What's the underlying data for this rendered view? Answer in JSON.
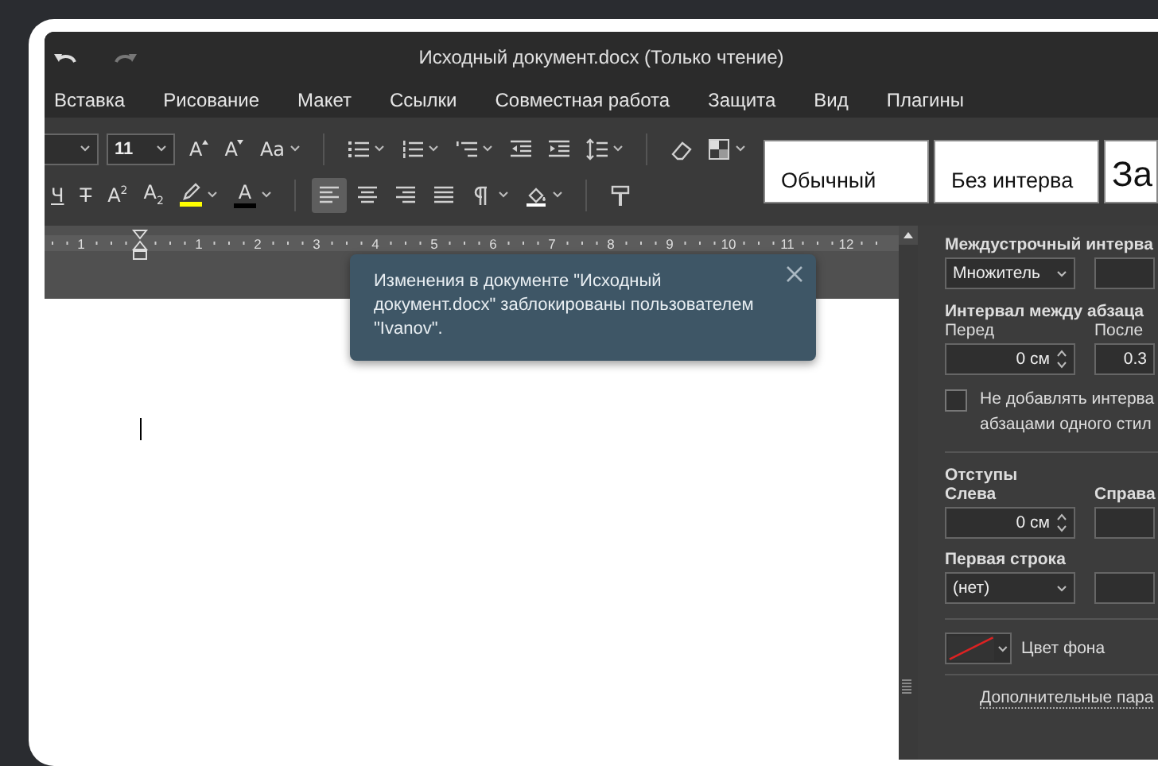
{
  "title_bar": {
    "title": "Исходный документ.docx (Только чтение)"
  },
  "menu": [
    "Вставка",
    "Рисование",
    "Макет",
    "Ссылки",
    "Совместная работа",
    "Защита",
    "Вид",
    "Плагины"
  ],
  "toolbar": {
    "font_size": "11",
    "row_1": [
      {
        "kind": "grow-font",
        "glyph": "A",
        "caret": false
      },
      {
        "kind": "shrink-font",
        "glyph": "A",
        "caret": false
      },
      {
        "kind": "change-case",
        "glyph": "Aa",
        "caret": true
      },
      {
        "kind": "sep"
      },
      {
        "kind": "bullets",
        "caret": true
      },
      {
        "kind": "numbering",
        "caret": true
      },
      {
        "kind": "multilevel",
        "caret": true
      },
      {
        "kind": "outdent",
        "caret": false
      },
      {
        "kind": "indent",
        "caret": false
      },
      {
        "kind": "line-spacing",
        "caret": true
      },
      {
        "kind": "sep"
      },
      {
        "kind": "eraser",
        "caret": false
      },
      {
        "kind": "shading",
        "caret": true
      }
    ],
    "row_2": [
      {
        "kind": "underline",
        "glyph": "Ч",
        "caret": false
      },
      {
        "kind": "strike",
        "glyph": "Т",
        "caret": false
      },
      {
        "kind": "superscript",
        "glyph": "A",
        "index": "2",
        "caret": false
      },
      {
        "kind": "subscript",
        "glyph": "A",
        "index": "2",
        "caret": false
      },
      {
        "kind": "highlight",
        "caret": true,
        "color": "#ffff00"
      },
      {
        "kind": "font-color",
        "glyph": "A",
        "caret": true,
        "color": "#000000"
      },
      {
        "kind": "sep"
      },
      {
        "kind": "align-left",
        "caret": false,
        "selected": true
      },
      {
        "kind": "align-center",
        "caret": false,
        "selected": false
      },
      {
        "kind": "align-right",
        "caret": false,
        "selected": false
      },
      {
        "kind": "justify",
        "caret": false,
        "selected": false
      },
      {
        "kind": "pilcrow",
        "caret": true
      },
      {
        "kind": "fill",
        "caret": true
      },
      {
        "kind": "sep"
      },
      {
        "kind": "format-painter",
        "caret": false
      }
    ],
    "styles": [
      {
        "kind": "normal",
        "label": "Обычный"
      },
      {
        "kind": "normal",
        "label": "Без интерва"
      },
      {
        "kind": "heading",
        "label": "За"
      }
    ]
  },
  "ruler": {
    "numbers": [
      "1",
      "1",
      "2",
      "3",
      "4",
      "5",
      "6",
      "7",
      "8",
      "9",
      "10",
      "11",
      "12"
    ]
  },
  "toast": {
    "message": "Изменения в документе \"Исходный документ.docx\" заблокированы пользователем \"Ivanov\"."
  },
  "paragraph_panel": {
    "line_spacing": {
      "heading": "Междустрочный интерва",
      "mode": "Множитель"
    },
    "paragraph_spacing": {
      "heading": "Интервал между абзаца",
      "before_label": "Перед",
      "before_value": "0 см",
      "after_label": "После",
      "after_value": "0.3"
    },
    "no_space_same_style": {
      "checked": false,
      "lines": [
        "Не добавлять интерва",
        "абзацами одного стил"
      ]
    },
    "indents": {
      "heading": "Отступы",
      "left_label": "Слева",
      "left_value": "0 см",
      "right_label": "Справа",
      "first_line_label": "Первая строка",
      "first_line_mode": "(нет)"
    },
    "background": {
      "label": "Цвет фона"
    },
    "advanced_link": "Дополнительные пара"
  }
}
